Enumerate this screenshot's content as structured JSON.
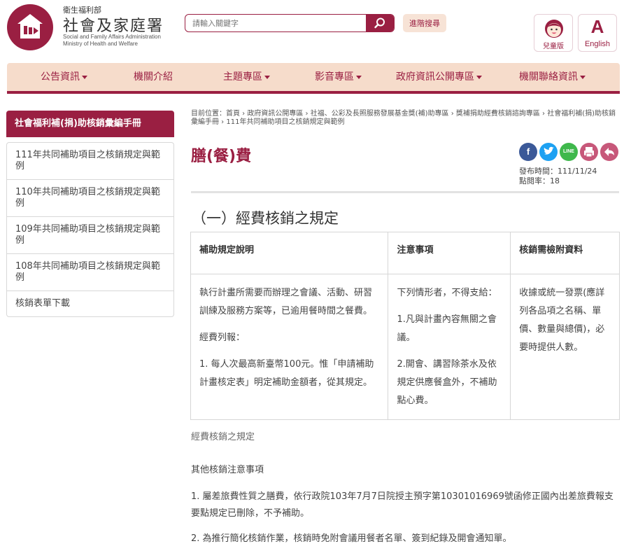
{
  "header": {
    "ministry_small": "衛生福利部",
    "agency_name": "社會及家庭署",
    "agency_en_1": "Social and Family Affairs Administration",
    "agency_en_2": "Ministry of Health and Welfare",
    "search_placeholder": "請輸入關鍵字",
    "advanced_search": "進階搜尋",
    "kids_label": "兒童版",
    "english_letter": "A",
    "english_label": "English",
    "brand_color": "#9a1f42"
  },
  "nav": {
    "items": [
      {
        "label": "公告資訊",
        "dropdown": true
      },
      {
        "label": "機關介紹",
        "dropdown": false
      },
      {
        "label": "主題專區",
        "dropdown": true
      },
      {
        "label": "影音專區",
        "dropdown": true
      },
      {
        "label": "政府資訊公開專區",
        "dropdown": true
      },
      {
        "label": "機關聯絡資訊",
        "dropdown": true
      }
    ]
  },
  "sidebar": {
    "title": "社會福利補(捐)助核銷彙編手冊",
    "items": [
      {
        "label": "111年共同補助項目之核銷規定與範例"
      },
      {
        "label": "110年共同補助項目之核銷規定與範例"
      },
      {
        "label": "109年共同補助項目之核銷規定與範例"
      },
      {
        "label": "108年共同補助項目之核銷規定與範例"
      },
      {
        "label": "核銷表單下載"
      }
    ]
  },
  "main": {
    "breadcrumb": "目前位置：首頁 › 政府資訊公開專區 › 社福、公彩及長照服務發展基金獎(補)助專區 › 獎補捐助經費核銷諮詢專區 › 社會福利補(捐)助核銷彙編手冊 › 111年共同補助項目之核銷規定與範例",
    "title": "膳(餐)費",
    "share_icons": [
      "facebook-icon",
      "twitter-icon",
      "line-icon",
      "print-icon",
      "back-icon"
    ],
    "publish_date": "發布時間：111/11/24",
    "click_rate": "點閱率：18",
    "section_title": "（一）經費核銷之規定",
    "table": {
      "headers": [
        "補助規定說明",
        "注意事項",
        "核銷需檢附資料"
      ],
      "col1": [
        "執行計畫所需要而辦理之會議、活動、研習訓練及服務方案等，已逾用餐時間之餐費。",
        "經費列報：",
        "1. 每人次最高新臺幣100元。惟「申請補助計畫核定表」明定補助金額者，從其規定。"
      ],
      "col2": [
        "下列情形者，不得支給：",
        "1.凡與計畫內容無關之會議。",
        "2.開會、講習除茶水及依規定供應餐盒外，不補助點心費。"
      ],
      "col3": [
        "收據或統一發票(應詳列各品項之名稱、單價、數量與總價)，必要時提供人數。"
      ]
    },
    "footnote": "經費核銷之規定",
    "other_title": "其他核銷注意事項",
    "note1": "1. 屬差旅費性質之膳費，依行政院103年7月7日院授主預字第10301016969號函修正國內出差旅費報支要點規定已刪除，不予補助。",
    "note2": "2. 為推行簡化核銷作業，核銷時免附會議用餐者名單、簽到紀錄及開會通知單。"
  }
}
